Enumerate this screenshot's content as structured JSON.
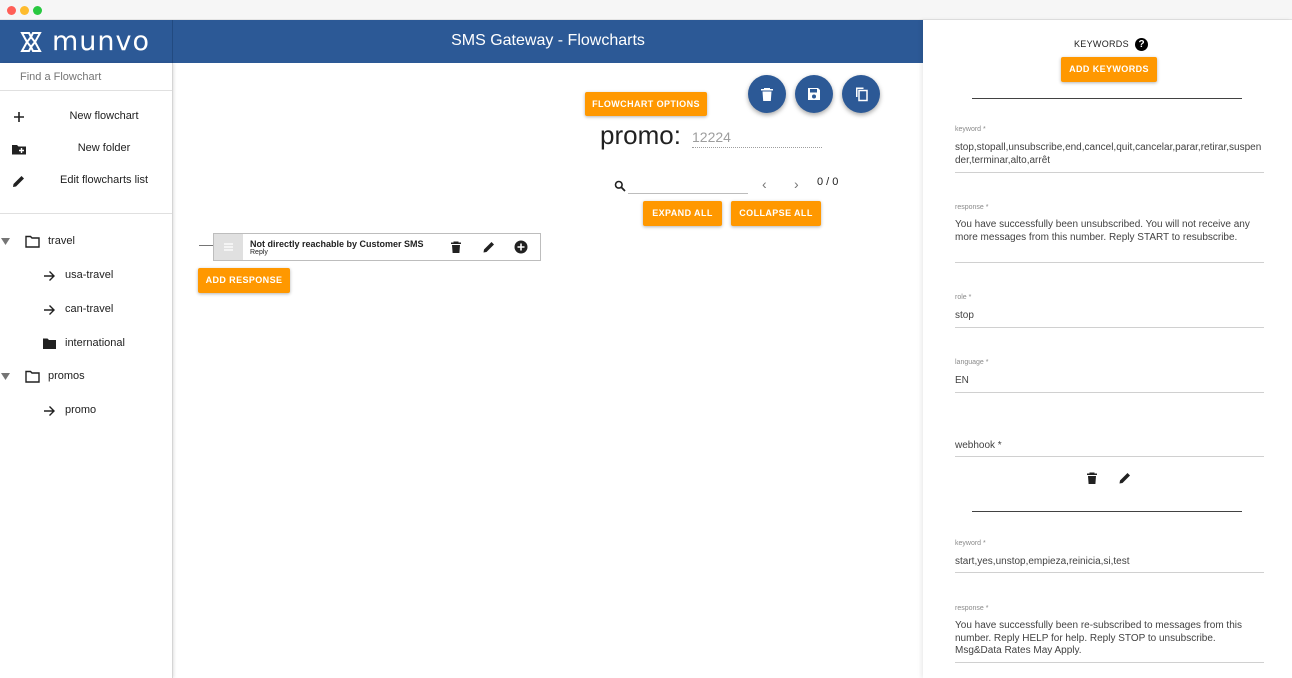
{
  "app": {
    "logo_text": "munvo",
    "page_title": "SMS Gateway - Flowcharts"
  },
  "sidebar": {
    "search_placeholder": "Find a Flowchart",
    "actions": [
      {
        "label": "New flowchart",
        "icon": "plus-icon"
      },
      {
        "label": "New folder",
        "icon": "folder-plus-icon"
      },
      {
        "label": "Edit flowcharts list",
        "icon": "pencil-icon"
      }
    ],
    "tree": {
      "travel": {
        "label": "travel",
        "children": [
          "usa-travel",
          "can-travel",
          "international"
        ]
      },
      "promos": {
        "label": "promos",
        "children": [
          "promo"
        ]
      }
    }
  },
  "main": {
    "flowchart_options_label": "FLOWCHART OPTIONS",
    "title": "promo:",
    "number": "12224",
    "counter": "0 / 0",
    "expand_all_label": "EXPAND ALL",
    "collapse_all_label": "COLLAPSE ALL",
    "add_response_label": "ADD RESPONSE",
    "node": {
      "title": "Not directly reachable by Customer SMS",
      "subtitle": "Reply"
    }
  },
  "keywords_panel": {
    "title": "KEYWORDS",
    "add_keywords_label": "ADD KEYWORDS",
    "entries": [
      {
        "keyword_label": "keyword *",
        "keyword_value": "stop,stopall,unsubscribe,end,cancel,quit,cancelar,parar,retirar,suspender,terminar,alto,arrêt",
        "response_label": "response *",
        "response_value": "You have successfully been unsubscribed. You will not receive any more messages from this number. Reply START to resubscribe.",
        "role_label": "role *",
        "role_value": "stop",
        "language_label": "language *",
        "language_value": "EN",
        "webhook_label": "webhook *"
      },
      {
        "keyword_label": "keyword *",
        "keyword_value": "start,yes,unstop,empieza,reinicia,si,test",
        "response_label": "response *",
        "response_value": "You have successfully been re-subscribed to messages from this number. Reply HELP for help. Reply STOP to unsubscribe. Msg&Data Rates May Apply."
      }
    ]
  },
  "colors": {
    "header": "#2c5996",
    "accent": "#ff9800",
    "fab": "#2c5996"
  }
}
